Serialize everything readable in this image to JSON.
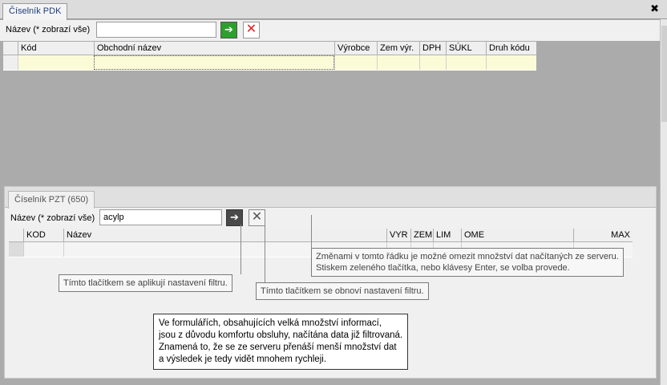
{
  "top": {
    "tab_title": "Číselník PDK",
    "close_glyph": "✖",
    "filter_label": "Název (* zobrazí vše)",
    "filter_value": "",
    "apply_glyph": "➔",
    "reset_glyph": "✕",
    "columns": [
      "Kód",
      "Obchodní název",
      "Výrobce",
      "Zem výr.",
      "DPH",
      "SÚKL",
      "Druh kódu"
    ]
  },
  "bottom": {
    "tab_title": "Číselník PZT (650)",
    "filter_label": "Název (* zobrazí vše)",
    "filter_value": "acylp",
    "apply_glyph": "➔",
    "reset_glyph": "✕",
    "columns": [
      "KOD",
      "Název",
      "VYR",
      "ZEM",
      "LIM",
      "OME",
      "MAX"
    ]
  },
  "tooltips": {
    "filter_row_line1": "Změnami v tomto řádku je možné omezit množství dat načítaných ze serveru.",
    "filter_row_line2": "Stiskem zeleného tlačítka, nebo klávesy Enter, se volba provede.",
    "apply_button": "Tímto tlačítkem se aplikují nastavení filtru.",
    "reset_button": "Tímto tlačítkem se obnoví nastavení filtru."
  },
  "note": {
    "lines": [
      "Ve formulářích, obsahujících velká množství informací,",
      "jsou z důvodu komfortu obsluhy, načítána data již filtrovaná.",
      "Znamená to, že se ze serveru přenáší menší množství dat",
      "a výsledek je tedy vidět mnohem rychleji."
    ]
  },
  "colors": {
    "accent_green": "#2ca02c",
    "reset_red": "#e02020",
    "selected_row": "#fbfbd8",
    "background_grey": "#ababab"
  }
}
